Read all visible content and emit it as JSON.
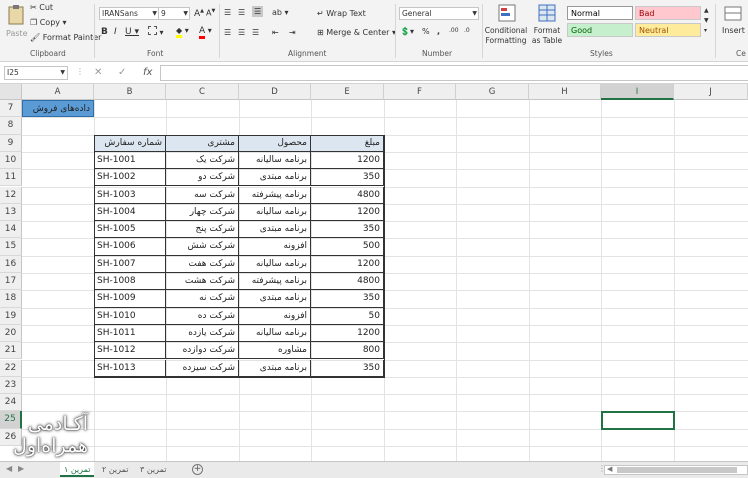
{
  "ribbon": {
    "paste": "Paste",
    "cut": "Cut",
    "copy": "Copy",
    "format_painter": "Format Painter",
    "clipboard": "Clipboard",
    "font_name": "IRANSans",
    "font_size": "9",
    "font_group": "Font",
    "wrap_text": "Wrap Text",
    "merge_center": "Merge & Center",
    "alignment": "Alignment",
    "number_format": "General",
    "number_group": "Number",
    "conditional_formatting": "Conditional Formatting",
    "format_as_table": "Format as Table",
    "styles": [
      {
        "label": "Normal",
        "bg": "#ffffff",
        "fg": "#000000"
      },
      {
        "label": "Bad",
        "bg": "#ffc7ce",
        "fg": "#9c0006"
      },
      {
        "label": "Good",
        "bg": "#c6efce",
        "fg": "#006100"
      },
      {
        "label": "Neutral",
        "bg": "#ffeb9c",
        "fg": "#9c5700"
      }
    ],
    "styles_group": "Styles",
    "insert": "Insert",
    "cells_label": "Ce"
  },
  "formula_bar": {
    "name_box": "I25",
    "fx": "fx",
    "value": ""
  },
  "columns": [
    "A",
    "B",
    "C",
    "D",
    "E",
    "F",
    "G",
    "H",
    "I",
    "J"
  ],
  "rows": [
    "7",
    "8",
    "9",
    "10",
    "11",
    "12",
    "13",
    "14",
    "15",
    "16",
    "17",
    "18",
    "19",
    "20",
    "21",
    "22",
    "23",
    "24",
    "25",
    "26"
  ],
  "sheet": {
    "title": "داده‌های فروش",
    "headers": [
      "شماره سفارش",
      "مشتری",
      "محصول",
      "مبلغ"
    ],
    "rows": [
      [
        "SH-1001",
        "شرکت یک",
        "برنامه سالیانه",
        "1200"
      ],
      [
        "SH-1002",
        "شرکت دو",
        "برنامه مبتدی",
        "350"
      ],
      [
        "SH-1003",
        "شرکت سه",
        "برنامه پیشرفته",
        "4800"
      ],
      [
        "SH-1004",
        "شرکت چهار",
        "برنامه سالیانه",
        "1200"
      ],
      [
        "SH-1005",
        "شرکت پنج",
        "برنامه مبتدی",
        "350"
      ],
      [
        "SH-1006",
        "شرکت شش",
        "افزونه",
        "500"
      ],
      [
        "SH-1007",
        "شرکت هفت",
        "برنامه سالیانه",
        "1200"
      ],
      [
        "SH-1008",
        "شرکت هشت",
        "برنامه پیشرفته",
        "4800"
      ],
      [
        "SH-1009",
        "شرکت نه",
        "برنامه مبتدی",
        "350"
      ],
      [
        "SH-1010",
        "شرکت ده",
        "افزونه",
        "50"
      ],
      [
        "SH-1011",
        "شرکت یازده",
        "برنامه سالیانه",
        "1200"
      ],
      [
        "SH-1012",
        "شرکت دوازده",
        "مشاوره",
        "800"
      ],
      [
        "SH-1013",
        "شرکت سیزده",
        "برنامه مبتدی",
        "350"
      ]
    ]
  },
  "tabs": [
    "تمرین ۱",
    "تمرین ۲",
    "تمرین ۳"
  ],
  "watermark": {
    "line1": "آکـادمی",
    "line2": "همراه‌اول"
  },
  "colors": {
    "title_fill": "#5b9bd5",
    "header_fill": "#dce6f1",
    "selection": "#217346"
  }
}
